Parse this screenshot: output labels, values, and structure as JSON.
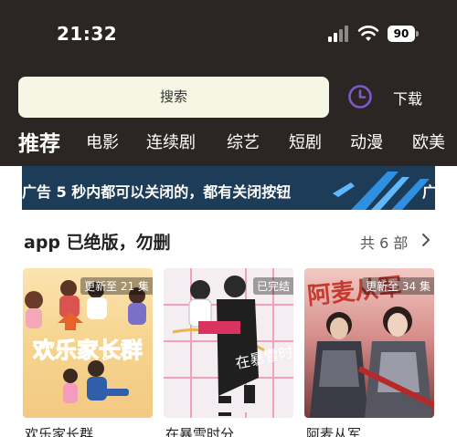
{
  "status_bar": {
    "time": "21:32",
    "battery": "90"
  },
  "header": {
    "search_placeholder": "搜索",
    "download_label": "下载",
    "tabs": [
      {
        "label": "推荐",
        "active": true
      },
      {
        "label": "电影"
      },
      {
        "label": "连续剧"
      },
      {
        "label": "综艺"
      },
      {
        "label": "短剧"
      },
      {
        "label": "动漫"
      },
      {
        "label": "欧美"
      }
    ]
  },
  "banner": {
    "text": "广告 5 秒内都可以关闭的，都有关闭按钮",
    "trailing": "广"
  },
  "section": {
    "title": "app 已绝版，勿删",
    "count_label": "共 6 部",
    "items": [
      {
        "title": "欢乐家长群",
        "badge": "更新至 21 集",
        "poster_text": "欢乐家长群"
      },
      {
        "title": "在暴雪时分",
        "badge": "已完结",
        "poster_text": "在暴雪时分"
      },
      {
        "title": "阿麦从军",
        "badge": "更新至 34 集",
        "poster_text": "阿麦从军"
      }
    ]
  },
  "colors": {
    "header_bg": "#2b2624",
    "search_bg": "#f6f6e4",
    "accent": "#7e59c9",
    "banner_bg": "#1d3c58"
  },
  "icons": {
    "history": "clock-icon",
    "more": "chevron-right-icon"
  }
}
